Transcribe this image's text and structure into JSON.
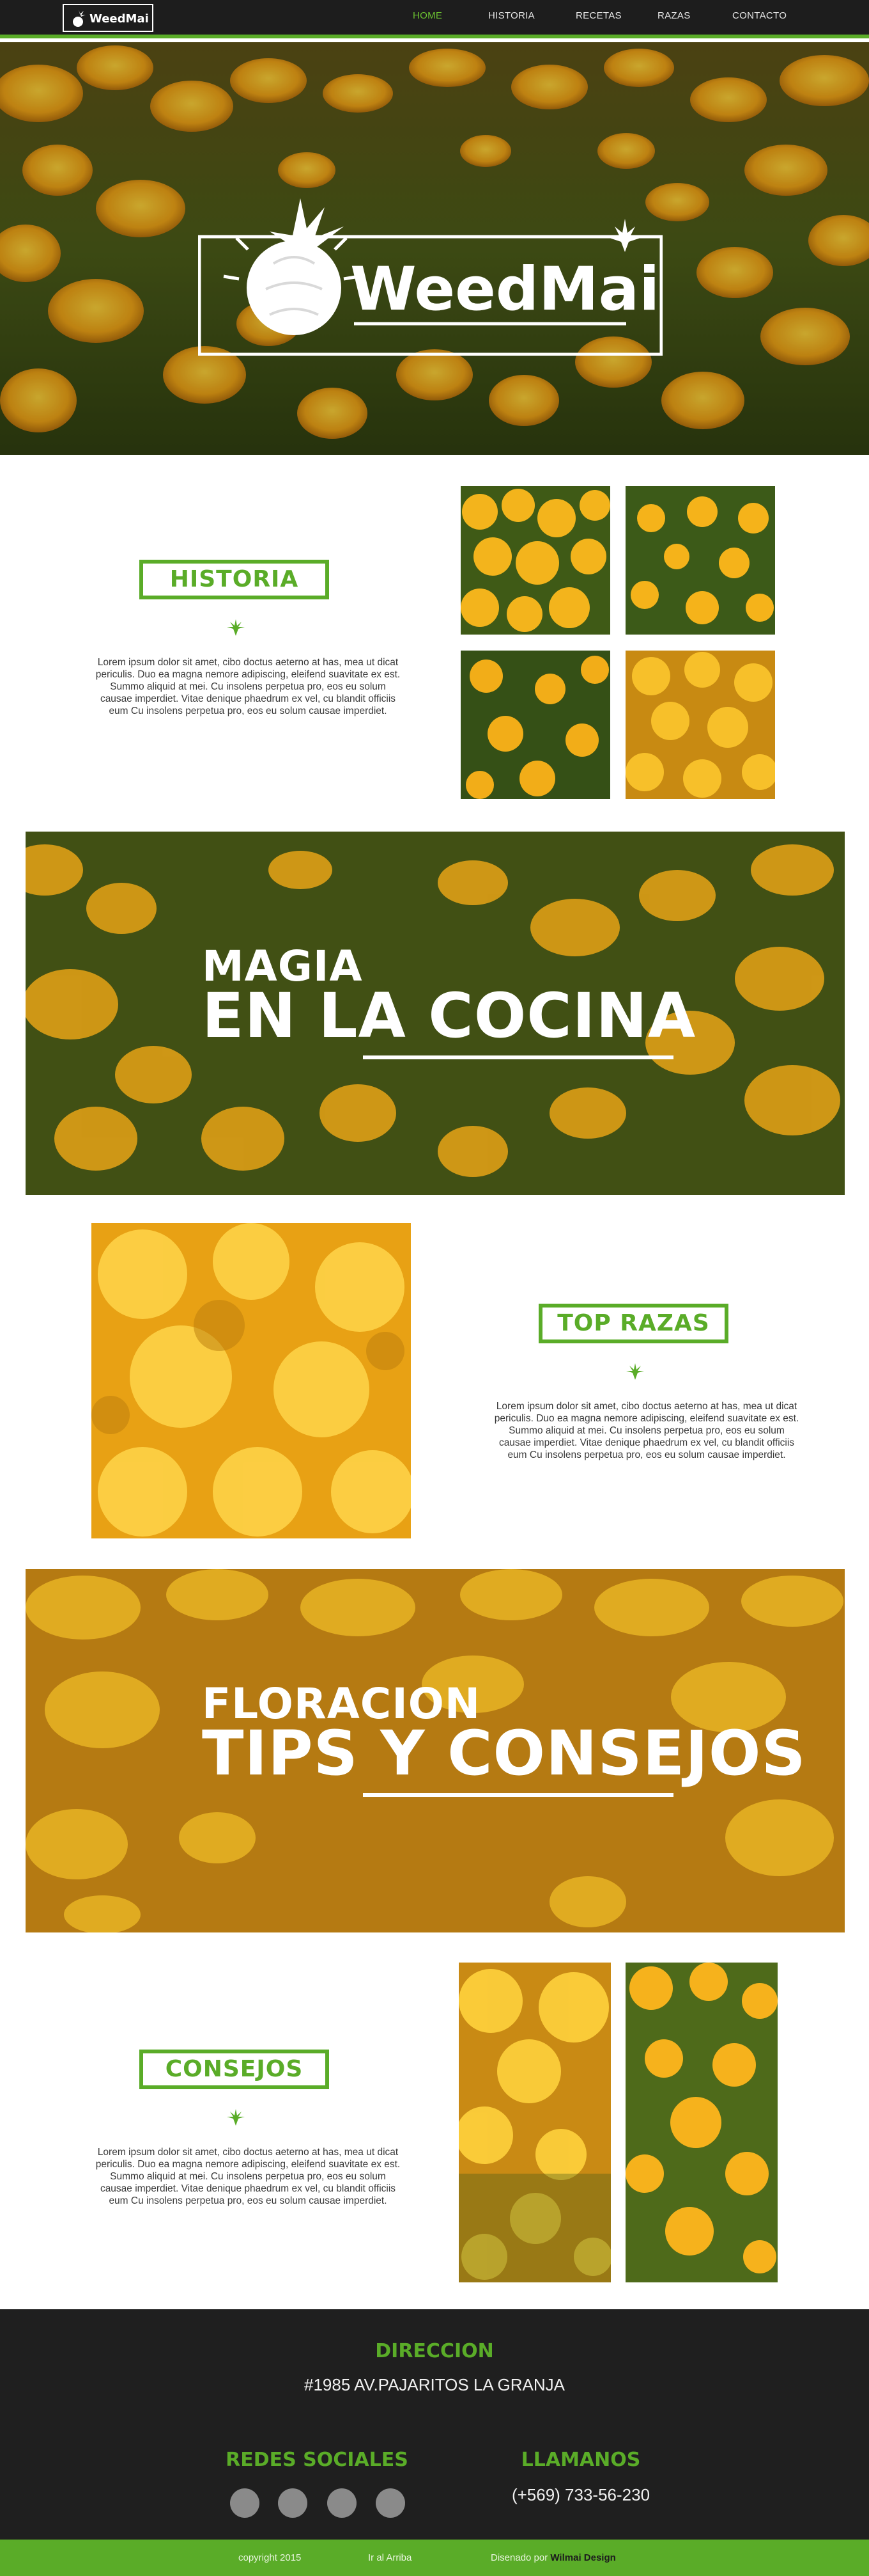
{
  "nav": {
    "logo_text": "WeedMai",
    "items": [
      {
        "label": "HOME",
        "active": true
      },
      {
        "label": "HISTORIA",
        "active": false
      },
      {
        "label": "RECETAS",
        "active": false
      },
      {
        "label": "RAZAS",
        "active": false
      },
      {
        "label": "CONTACTO",
        "active": false
      }
    ]
  },
  "hero": {
    "logo_text": "WeedMai"
  },
  "historia": {
    "title": "HISTORIA",
    "body": "Lorem ipsum dolor sit amet, cibo doctus aeterno at has, mea ut dicat periculis. Duo ea magna nemore adipiscing, eleifend suavitate ex est. Summo aliquid at mei. Cu insolens perpetua pro, eos eu solum causae imperdiet. Vitae denique phaedrum ex vel, cu blandit officiis eum Cu insolens perpetua pro, eos eu solum causae imperdiet."
  },
  "banner1": {
    "line1": "MAGIA",
    "line2": "EN LA COCINA"
  },
  "razas": {
    "title": "TOP RAZAS",
    "body": "Lorem ipsum dolor sit amet, cibo doctus aeterno at has, mea ut dicat periculis. Duo ea magna nemore adipiscing, eleifend suavitate ex est. Summo aliquid at mei. Cu insolens perpetua pro, eos eu solum causae imperdiet. Vitae denique phaedrum ex vel, cu blandit officiis eum Cu insolens perpetua pro, eos eu solum causae imperdiet."
  },
  "banner2": {
    "line1": "FLORACION",
    "line2": "TIPS Y CONSEJOS"
  },
  "consejos": {
    "title": "CONSEJOS",
    "body": "Lorem ipsum dolor sit amet, cibo doctus aeterno at has, mea ut dicat periculis. Duo ea magna nemore adipiscing, eleifend suavitate ex est. Summo aliquid at mei. Cu insolens perpetua pro, eos eu solum causae imperdiet. Vitae denique phaedrum ex vel, cu blandit officiis eum Cu insolens perpetua pro, eos eu solum causae imperdiet."
  },
  "footer": {
    "direccion_title": "DIRECCION",
    "direccion": "#1985 AV.PAJARITOS LA GRANJA",
    "redes_title": "REDES SOCIALES",
    "llamanos_title": "LLAMANOS",
    "phone": "(+569) 733-56-230",
    "copyright": "copyright 2015",
    "top_link": "Ir al Arriba",
    "designed_by": "Disenado por ",
    "designer": "Wilmai Design"
  },
  "colors": {
    "accent": "#5aac28",
    "nav_bg": "#1d1d1d",
    "footer_bg": "#1f1f1f",
    "flower": "#f4b61c",
    "foliage": "#3f5a16"
  },
  "icons": [
    "weed-leaf-icon",
    "pineapple-logo-icon",
    "social-circle-icon"
  ]
}
